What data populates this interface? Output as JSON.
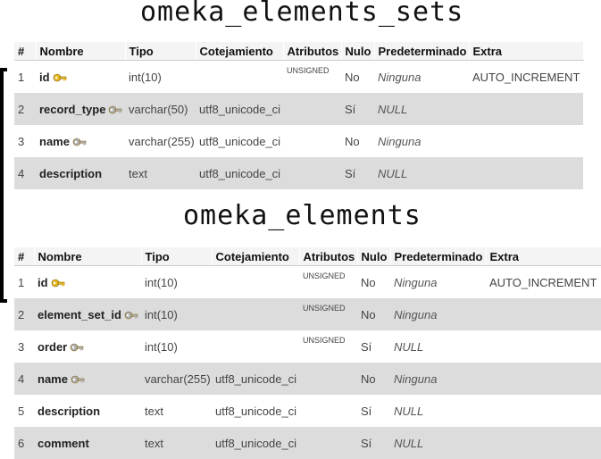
{
  "tables": [
    {
      "title": "omeka_elements_sets",
      "headers": [
        "#",
        "Nombre",
        "Tipo",
        "Cotejamiento",
        "Atributos",
        "Nulo",
        "Predeterminado",
        "Extra"
      ],
      "rows": [
        {
          "num": "1",
          "name": "id",
          "key": "primary",
          "type": "int(10)",
          "collation": "",
          "attributes": "UNSIGNED",
          "null": "No",
          "default": "Ninguna",
          "extra": "AUTO_INCREMENT"
        },
        {
          "num": "2",
          "name": "record_type",
          "key": "index",
          "type": "varchar(50)",
          "collation": "utf8_unicode_ci",
          "attributes": "",
          "null": "Sí",
          "default": "NULL",
          "extra": ""
        },
        {
          "num": "3",
          "name": "name",
          "key": "index",
          "type": "varchar(255)",
          "collation": "utf8_unicode_ci",
          "attributes": "",
          "null": "No",
          "default": "Ninguna",
          "extra": ""
        },
        {
          "num": "4",
          "name": "description",
          "key": "",
          "type": "text",
          "collation": "utf8_unicode_ci",
          "attributes": "",
          "null": "Sí",
          "default": "NULL",
          "extra": ""
        }
      ]
    },
    {
      "title": "omeka_elements",
      "headers": [
        "#",
        "Nombre",
        "Tipo",
        "Cotejamiento",
        "Atributos",
        "Nulo",
        "Predeterminado",
        "Extra"
      ],
      "rows": [
        {
          "num": "1",
          "name": "id",
          "key": "primary",
          "type": "int(10)",
          "collation": "",
          "attributes": "UNSIGNED",
          "null": "No",
          "default": "Ninguna",
          "extra": "AUTO_INCREMENT"
        },
        {
          "num": "2",
          "name": "element_set_id",
          "key": "index",
          "type": "int(10)",
          "collation": "",
          "attributes": "UNSIGNED",
          "null": "No",
          "default": "Ninguna",
          "extra": ""
        },
        {
          "num": "3",
          "name": "order",
          "key": "index",
          "type": "int(10)",
          "collation": "",
          "attributes": "UNSIGNED",
          "null": "Sí",
          "default": "NULL",
          "extra": ""
        },
        {
          "num": "4",
          "name": "name",
          "key": "index",
          "type": "varchar(255)",
          "collation": "utf8_unicode_ci",
          "attributes": "",
          "null": "No",
          "default": "Ninguna",
          "extra": ""
        },
        {
          "num": "5",
          "name": "description",
          "key": "",
          "type": "text",
          "collation": "utf8_unicode_ci",
          "attributes": "",
          "null": "Sí",
          "default": "NULL",
          "extra": ""
        },
        {
          "num": "6",
          "name": "comment",
          "key": "",
          "type": "text",
          "collation": "utf8_unicode_ci",
          "attributes": "",
          "null": "Sí",
          "default": "NULL",
          "extra": ""
        }
      ]
    }
  ],
  "colors": {
    "primary_key": "#e8b820",
    "index_key": "#b0b0b0",
    "row_alt": "#dcdcdc"
  },
  "icons": {
    "primary": "primary-key-icon",
    "index": "index-key-icon"
  }
}
